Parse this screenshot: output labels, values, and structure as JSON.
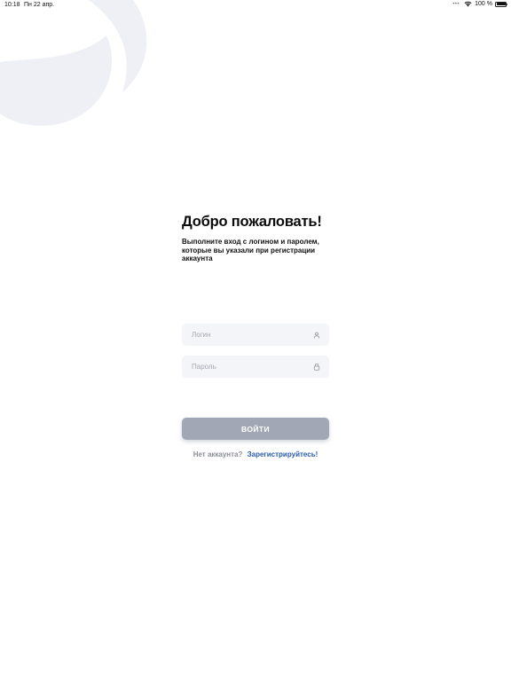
{
  "status_bar": {
    "time": "10:18",
    "date": "Пн 22 апр.",
    "battery_percent": "100 %",
    "battery_level": 1.0
  },
  "welcome": {
    "title": "Добро пожаловать!",
    "subtitle": "Выполните вход с логином и паролем, которые вы указали при регистрации аккаунта"
  },
  "form": {
    "login_placeholder": "Логин",
    "login_value": "",
    "login_icon": "user-icon",
    "password_placeholder": "Пароль",
    "password_value": "",
    "password_icon": "lock-icon",
    "submit_label": "ВОЙТИ"
  },
  "register": {
    "prompt": "Нет аккаунта?",
    "link_label": "Зарегистрируйтесь!"
  },
  "colors": {
    "field_background": "#f4f5f9",
    "button_disabled": "#a1a7b4",
    "link": "#2a5cb0",
    "decor": "#eef0f6"
  }
}
